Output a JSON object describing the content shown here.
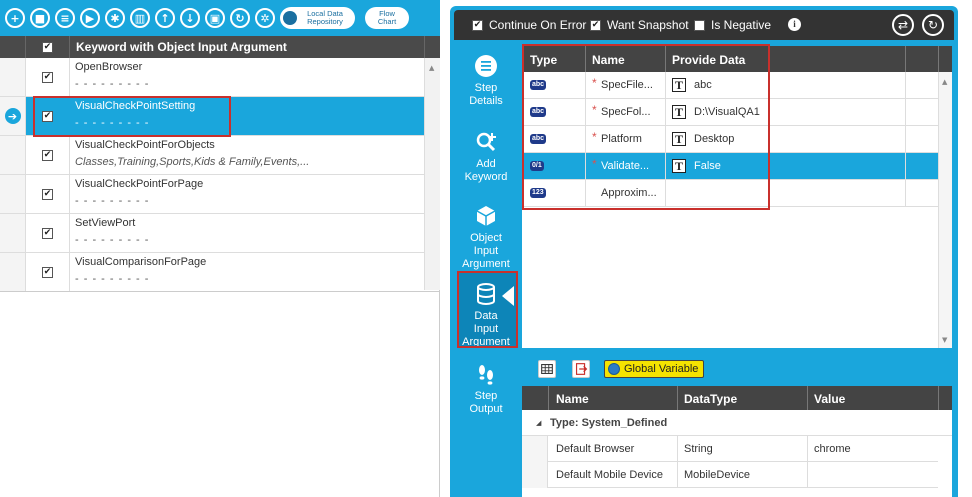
{
  "left_toolbar": {
    "buttons": [
      {
        "icon": "plus-icon",
        "glyph": "+"
      },
      {
        "icon": "video-icon",
        "glyph": "■"
      },
      {
        "icon": "list-icon",
        "glyph": "≡"
      },
      {
        "icon": "play-icon",
        "glyph": "▶"
      },
      {
        "icon": "bug-icon",
        "glyph": "✱"
      },
      {
        "icon": "trash-icon",
        "glyph": "▥"
      },
      {
        "icon": "arrow-up-icon",
        "glyph": "↑"
      },
      {
        "icon": "arrow-down-icon",
        "glyph": "↓"
      },
      {
        "icon": "save-icon",
        "glyph": "▣"
      },
      {
        "icon": "refresh-icon",
        "glyph": "↻"
      },
      {
        "icon": "settings-icon",
        "glyph": "✲"
      }
    ],
    "local_repo_line1": "Local Data",
    "local_repo_line2": "Repository",
    "flow_line1": "Flow",
    "flow_line2": "Chart"
  },
  "keyword_grid": {
    "header_check": "✔",
    "header_title": "Keyword with Object Input Argument",
    "rows": [
      {
        "name": "OpenBrowser",
        "sub": "- - - - - - - - -",
        "checked": "✔"
      },
      {
        "name": "VisualCheckPointSetting",
        "sub": "- - - - - - - - -",
        "checked": "✔"
      },
      {
        "name": "VisualCheckPointForObjects",
        "sub": "Classes,Training,Sports,Kids & Family,Events,...",
        "checked": "✔"
      },
      {
        "name": "VisualCheckPointForPage",
        "sub": "- - - - - - - - -",
        "checked": "✔"
      },
      {
        "name": "SetViewPort",
        "sub": "- - - - - - - - -",
        "checked": "✔"
      },
      {
        "name": "VisualComparisonForPage",
        "sub": "- - - - - - - - -",
        "checked": "✔"
      }
    ],
    "current_indicator": "➔"
  },
  "options": {
    "continue_on_error": "Continue On Error",
    "want_snapshot": "Want Snapshot",
    "is_negative": "Is Negative",
    "continue_checked": "✔",
    "snapshot_checked": "✔",
    "negative_checked": "",
    "info_glyph": "i",
    "swap_glyph": "⇄",
    "refresh_glyph": "↻"
  },
  "side_nav": {
    "step_details": [
      "Step",
      "Details"
    ],
    "add_keyword": [
      "Add",
      "Keyword"
    ],
    "object_input": [
      "Object",
      "Input",
      "Argument"
    ],
    "data_input": [
      "Data",
      "Input",
      "Argument"
    ],
    "step_output": [
      "Step",
      "Output"
    ]
  },
  "data_grid": {
    "headers": {
      "type": "Type",
      "name": "Name",
      "provide_data": "Provide Data"
    },
    "rows": [
      {
        "type": "abc",
        "required": "*",
        "name": "SpecFile...",
        "value_icon": "T",
        "value": "abc"
      },
      {
        "type": "abc",
        "required": "*",
        "name": "SpecFol...",
        "value_icon": "T",
        "value": "D:\\VisualQA1"
      },
      {
        "type": "abc",
        "required": "*",
        "name": "Platform",
        "value_icon": "T",
        "value": "Desktop"
      },
      {
        "type": "0/1",
        "required": "*",
        "name": "Validate...",
        "value_icon": "T",
        "value": "False"
      },
      {
        "type": "123",
        "required": "",
        "name": "Approxim...",
        "value_icon": "",
        "value": ""
      }
    ],
    "scroll_up": "▲",
    "scroll_down": "▼"
  },
  "global_vars": {
    "button_label": "Global Variable",
    "headers": {
      "name": "Name",
      "datatype": "DataType",
      "value": "Value"
    },
    "group_label": "Type: System_Defined",
    "group_toggle": "◢",
    "rows": [
      {
        "name": "Default Browser",
        "datatype": "String",
        "value": "chrome"
      },
      {
        "name": "Default Mobile Device",
        "datatype": "MobileDevice",
        "value": ""
      }
    ]
  },
  "colors": {
    "accent": "#1aa6dc",
    "header_dark": "#444444",
    "highlight_red": "#c9302c",
    "global_btn": "#f5e300"
  }
}
